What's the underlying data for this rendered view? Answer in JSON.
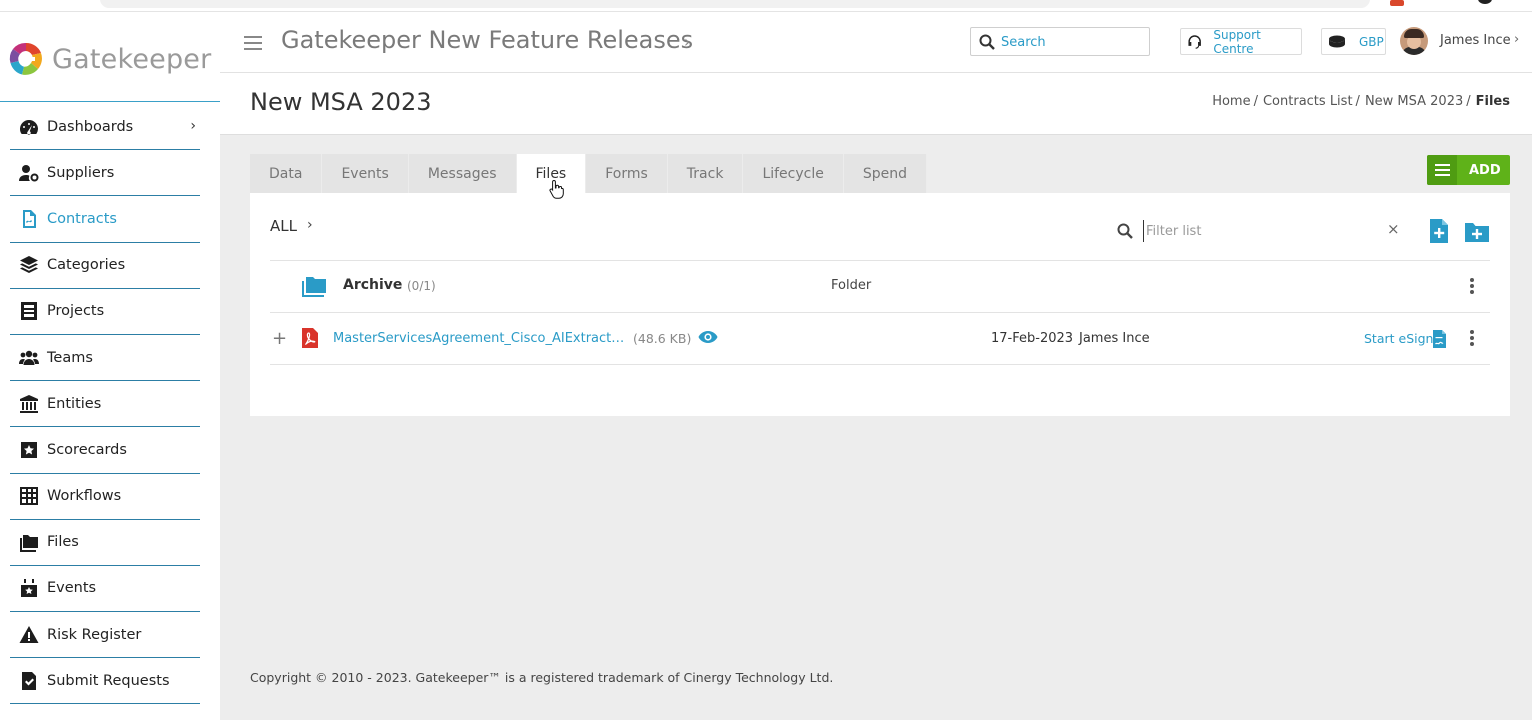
{
  "app": {
    "logo_text": "Gatekeeper",
    "title": "Gatekeeper New Feature Releases"
  },
  "header": {
    "search_placeholder": "Search",
    "support_label": "Support Centre",
    "currency_label": "GBP",
    "user_name": "James Ince"
  },
  "sidebar": {
    "items": [
      {
        "label": "Dashboards",
        "icon": "gauge-icon"
      },
      {
        "label": "Suppliers",
        "icon": "user-gear-icon"
      },
      {
        "label": "Contracts",
        "icon": "contract-icon"
      },
      {
        "label": "Categories",
        "icon": "layers-icon"
      },
      {
        "label": "Projects",
        "icon": "projects-icon"
      },
      {
        "label": "Teams",
        "icon": "users-icon"
      },
      {
        "label": "Entities",
        "icon": "institution-icon"
      },
      {
        "label": "Scorecards",
        "icon": "star-card-icon"
      },
      {
        "label": "Workflows",
        "icon": "grid-icon"
      },
      {
        "label": "Files",
        "icon": "folders-icon"
      },
      {
        "label": "Events",
        "icon": "calendar-icon"
      },
      {
        "label": "Risk Register",
        "icon": "warning-icon"
      },
      {
        "label": "Submit Requests",
        "icon": "file-check-icon"
      }
    ],
    "active": "Contracts"
  },
  "page": {
    "title": "New MSA 2023",
    "breadcrumb": [
      "Home",
      "Contracts List",
      "New MSA 2023",
      "Files"
    ],
    "breadcrumb_sep": "/"
  },
  "tabs": [
    "Data",
    "Events",
    "Messages",
    "Files",
    "Forms",
    "Track",
    "Lifecycle",
    "Spend"
  ],
  "active_tab": "Files",
  "add_button_label": "ADD",
  "files_panel": {
    "path_label": "ALL",
    "filter_placeholder": "Filter list",
    "clear_symbol": "×",
    "rows": [
      {
        "type_kind": "folder",
        "name": "Archive",
        "count": "(0/1)",
        "type_label": "Folder"
      },
      {
        "type_kind": "pdf",
        "expand": "+",
        "name": "MasterServicesAgreement_Cisco_AIExtractTes...",
        "size": "(48.6 KB)",
        "date": "17-Feb-2023",
        "owner": "James Ince",
        "action": "Start eSign"
      }
    ]
  },
  "footer": "Copyright © 2010 - 2023. Gatekeeper™ is a registered trademark of Cinergy Technology Ltd.",
  "colors": {
    "accent": "#2a9bc7",
    "add_green": "#5fb219",
    "pdf_red": "#d9342b",
    "background": "#ededed"
  }
}
